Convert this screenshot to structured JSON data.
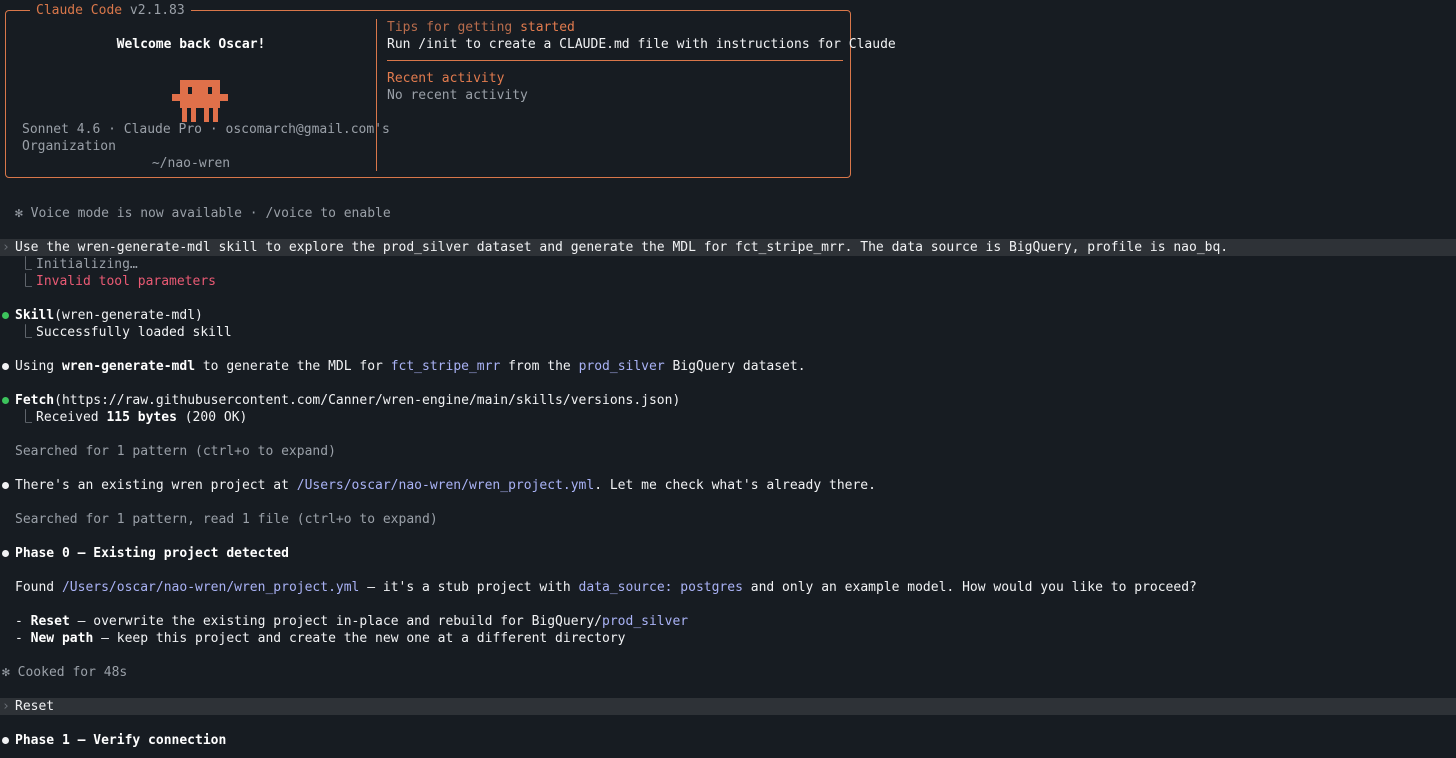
{
  "header": {
    "app_title": "Claude Code",
    "version": "v2.1.83",
    "welcome": "Welcome back Oscar!",
    "account_line": "Sonnet 4.6 · Claude Pro · oscomarch@gmail.com's",
    "org_line": "Organization",
    "cwd": "~/nao-wren",
    "tips_title_a": "Tips for getting ",
    "tips_title_b": "started",
    "tips_text": "Run /init to create a CLAUDE.md file with instructions for Claude",
    "recent_title": "Recent activity",
    "recent_text": "No recent activity"
  },
  "voice_notice": "✻ Voice mode is now available · /voice to enable",
  "prompt_1": "Use the wren-generate-mdl skill to explore the prod_silver dataset and generate the MDL for fct_stripe_mrr. The data source is BigQuery, profile is nao_bq.",
  "initializing": "Initializing…",
  "invalid_params": "Invalid tool parameters",
  "skill": {
    "name": "Skill",
    "arg": "(wren-generate-mdl)",
    "result": "Successfully loaded skill"
  },
  "using_line": {
    "a": "Using ",
    "skill": "wren-generate-mdl",
    "b": " to generate the MDL for ",
    "table": "fct_stripe_mrr",
    "c": " from the ",
    "dataset": "prod_silver",
    "d": " BigQuery dataset."
  },
  "fetch": {
    "name": "Fetch",
    "arg": "(https://raw.githubusercontent.com/Canner/wren-engine/main/skills/versions.json)",
    "received_a": "Received ",
    "received_b": "115 bytes",
    "received_c": " (200 OK)"
  },
  "searched_1": "Searched for 1 pattern (ctrl+o to expand)",
  "existing_line": {
    "a": "There's an existing wren project at ",
    "path": "/Users/oscar/nao-wren/wren_project.yml",
    "b": ". Let me check what's already there."
  },
  "searched_2": "Searched for 1 pattern, read 1 file (ctrl+o to expand)",
  "phase0": "Phase 0 — Existing project detected",
  "found_line": {
    "a": "Found ",
    "path": "/Users/oscar/nao-wren/wren_project.yml",
    "b": " — it's a stub project with ",
    "ds": "data_source: postgres",
    "c": " and only an example model. How would you like to proceed?"
  },
  "options": [
    {
      "dash": "- ",
      "name": "Reset",
      "text": " — overwrite the existing project in-place and rebuild for BigQuery/",
      "hl": "prod_silver"
    },
    {
      "dash": "- ",
      "name": "New path",
      "text": " — keep this project and create the new one at a different directory",
      "hl": ""
    }
  ],
  "cooked": "✻ Cooked for 48s",
  "prompt_2": "Reset",
  "phase1": "Phase 1 — Verify connection",
  "colors": {
    "accent": "#e27b4e",
    "error": "#ea5a74",
    "path": "#a9b2f5",
    "success": "#3cc35c"
  },
  "icons": [
    "mascot-icon",
    "prompt-caret-icon",
    "bullet-icon",
    "tree-branch-icon",
    "sparkle-icon"
  ]
}
